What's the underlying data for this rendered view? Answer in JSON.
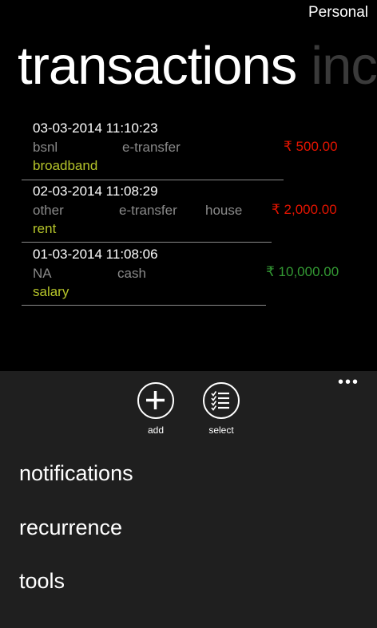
{
  "header": {
    "account": "Personal"
  },
  "pivot": {
    "title": "transactions",
    "next_title": "inc"
  },
  "transactions": [
    {
      "date": "03-03-2014 11:10:23",
      "payee": "bsnl",
      "mode": "e-transfer",
      "tag": "",
      "category": "broadband",
      "amount": "₹ 500.00",
      "amount_color": "#e51400"
    },
    {
      "date": "02-03-2014 11:08:29",
      "payee": "other",
      "mode": "e-transfer",
      "tag": "house",
      "category": "rent",
      "amount": "₹ 2,000.00",
      "amount_color": "#e51400"
    },
    {
      "date": "01-03-2014 11:08:06",
      "payee": "NA",
      "mode": "cash",
      "tag": "",
      "category": "salary",
      "amount": "₹ 10,000.00",
      "amount_color": "#339933"
    }
  ],
  "appbar": {
    "buttons": [
      {
        "label": "add",
        "icon": "plus-icon"
      },
      {
        "label": "select",
        "icon": "checklist-icon"
      }
    ],
    "menu": [
      {
        "label": "notifications"
      },
      {
        "label": "recurrence"
      },
      {
        "label": "tools"
      }
    ],
    "more": "•••"
  }
}
